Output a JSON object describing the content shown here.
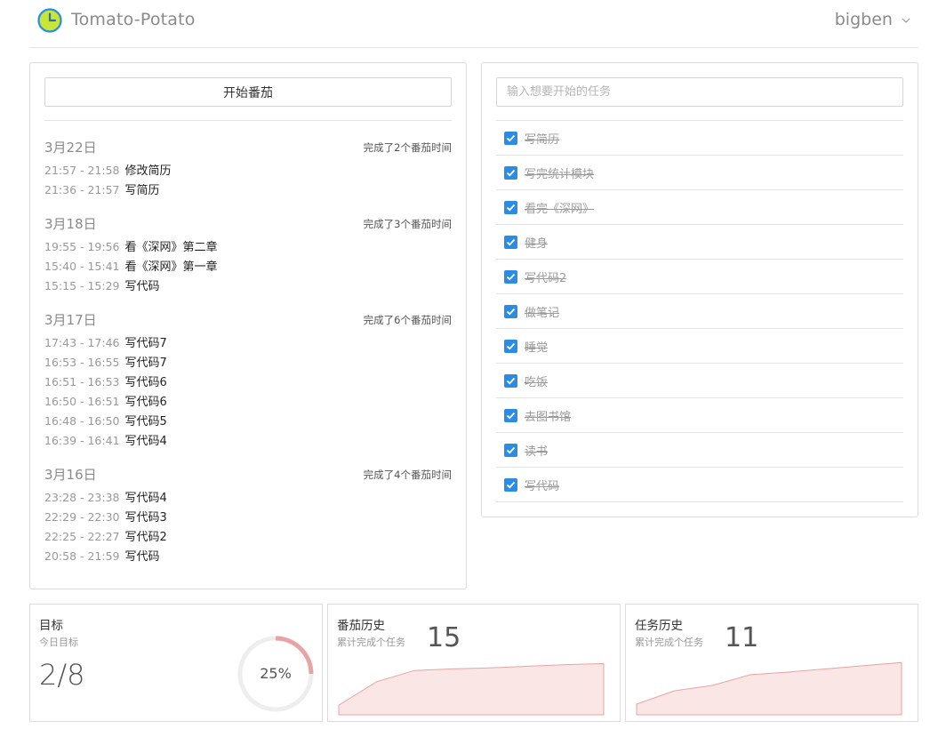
{
  "header": {
    "app_title": "Tomato-Potato",
    "user_name": "bigben",
    "logo_icon": "clock-icon",
    "colors": {
      "logo_ring": "#2b8ce6",
      "logo_fill": "#c8e636"
    }
  },
  "left": {
    "start_button": "开始番茄",
    "days": [
      {
        "date": "3月22日",
        "summary": "完成了2个番茄时间",
        "items": [
          {
            "time": "21:57 - 21:58",
            "desc": "修改简历"
          },
          {
            "time": "21:36 - 21:57",
            "desc": "写简历"
          }
        ]
      },
      {
        "date": "3月18日",
        "summary": "完成了3个番茄时间",
        "items": [
          {
            "time": "19:55 - 19:56",
            "desc": "看《深网》第二章"
          },
          {
            "time": "15:40 - 15:41",
            "desc": "看《深网》第一章"
          },
          {
            "time": "15:15 - 15:29",
            "desc": "写代码"
          }
        ]
      },
      {
        "date": "3月17日",
        "summary": "完成了6个番茄时间",
        "items": [
          {
            "time": "17:43 - 17:46",
            "desc": "写代码7"
          },
          {
            "time": "16:53 - 16:55",
            "desc": "写代码7"
          },
          {
            "time": "16:51 - 16:53",
            "desc": "写代码6"
          },
          {
            "time": "16:50 - 16:51",
            "desc": "写代码6"
          },
          {
            "time": "16:48 - 16:50",
            "desc": "写代码5"
          },
          {
            "time": "16:39 - 16:41",
            "desc": "写代码4"
          }
        ]
      },
      {
        "date": "3月16日",
        "summary": "完成了4个番茄时间",
        "items": [
          {
            "time": "23:28 - 23:38",
            "desc": "写代码4"
          },
          {
            "time": "22:29 - 22:30",
            "desc": "写代码3"
          },
          {
            "time": "22:25 - 22:27",
            "desc": "写代码2"
          },
          {
            "time": "20:58 - 21:59",
            "desc": "写代码"
          }
        ]
      }
    ]
  },
  "tasks": {
    "input_placeholder": "输入想要开始的任务",
    "items": [
      {
        "label": "写简历",
        "done": true
      },
      {
        "label": "写完统计模块",
        "done": true
      },
      {
        "label": "看完《深网》",
        "done": true
      },
      {
        "label": "健身",
        "done": true
      },
      {
        "label": "写代码2",
        "done": true
      },
      {
        "label": "做笔记",
        "done": true
      },
      {
        "label": "睡觉",
        "done": true
      },
      {
        "label": "吃饭",
        "done": true
      },
      {
        "label": "去图书馆",
        "done": true
      },
      {
        "label": "读书",
        "done": true
      },
      {
        "label": "写代码",
        "done": true
      }
    ],
    "checkbox_color": "#2b8ce6"
  },
  "stats": {
    "goal": {
      "title": "目标",
      "subtitle": "今日目标",
      "value": "2/8",
      "percent_label": "25%",
      "percent": 0.25,
      "ring_color": "#e8a4a4",
      "track_color": "#eeeeee"
    },
    "tomato_history": {
      "title": "番茄历史",
      "subtitle": "累计完成个任务",
      "count": "15",
      "trend": [
        0.18,
        0.62,
        0.83,
        0.86,
        0.88,
        0.91,
        0.94,
        0.96
      ]
    },
    "task_history": {
      "title": "任务历史",
      "subtitle": "累计完成个任务",
      "count": "11",
      "trend": [
        0.2,
        0.45,
        0.55,
        0.75,
        0.8,
        0.86,
        0.92,
        0.98
      ],
      "fill_color": "#fbe6e6",
      "line_color": "#e8a4a4"
    }
  }
}
